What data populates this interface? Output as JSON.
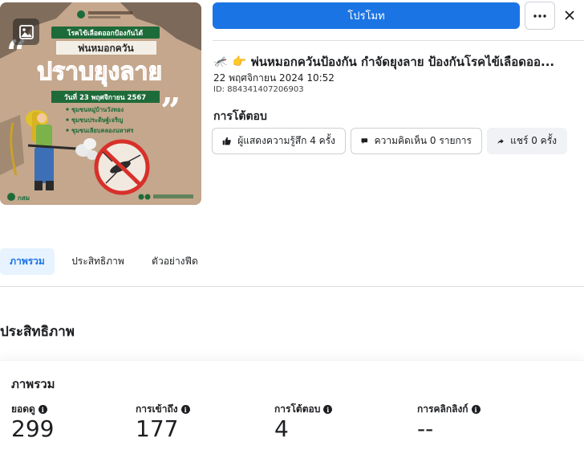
{
  "header": {
    "promote_label": "โปรโมท",
    "more_icon": "more-icon",
    "close_icon": "close-icon"
  },
  "thumbnail": {
    "gallery_icon": "gallery-icon",
    "headline_top": "โรคไข้เลือดออกป้องกันได้",
    "headline_mid": "พ่นหมอกควัน",
    "headline_main": "ปราบยุงลาย",
    "date_line": "วันที่ 23 พฤศจิกายน 2567",
    "bullets": [
      "ชุมชนหมู่บ้านวังทอง",
      "ชุมชนประดิษฐ์เจริญ",
      "ชุมชนเลียบคลองนหาศร"
    ],
    "logo_text": "กสม"
  },
  "post": {
    "title": "พ่นหมอกควันป้องกัน กำจัดยุงลาย ป้องกันโรคไข้เลือดออ...",
    "emoji_1": "🦟",
    "emoji_2": "👉",
    "date": "22 พฤศจิกายน 2024 10:52",
    "id_label": "ID: 884341407206903"
  },
  "interactions": {
    "title": "การโต้ตอบ",
    "reactions_label": "ผู้แสดงความรู้สึก 4 ครั้ง",
    "comments_label": "ความคิดเห็น 0 รายการ",
    "shares_label": "แชร์ 0 ครั้ง"
  },
  "tabs": [
    {
      "label": "ภาพรวม",
      "active": true
    },
    {
      "label": "ประสิทธิภาพ",
      "active": false
    },
    {
      "label": "ตัวอย่างฟีด",
      "active": false
    }
  ],
  "performance": {
    "heading": "ประสิทธิภาพ",
    "card_title": "ภาพรวม",
    "metrics": [
      {
        "label": "ยอดดู",
        "value": "299"
      },
      {
        "label": "การเข้าถึง",
        "value": "177"
      },
      {
        "label": "การโต้ตอบ",
        "value": "4"
      },
      {
        "label": "การคลิกลิงก์",
        "value": "--"
      }
    ]
  },
  "colors": {
    "primary": "#1b74e4",
    "poster_bg": "#c4a78c",
    "poster_red": "#d8302a",
    "poster_green": "#1e6b3a"
  }
}
